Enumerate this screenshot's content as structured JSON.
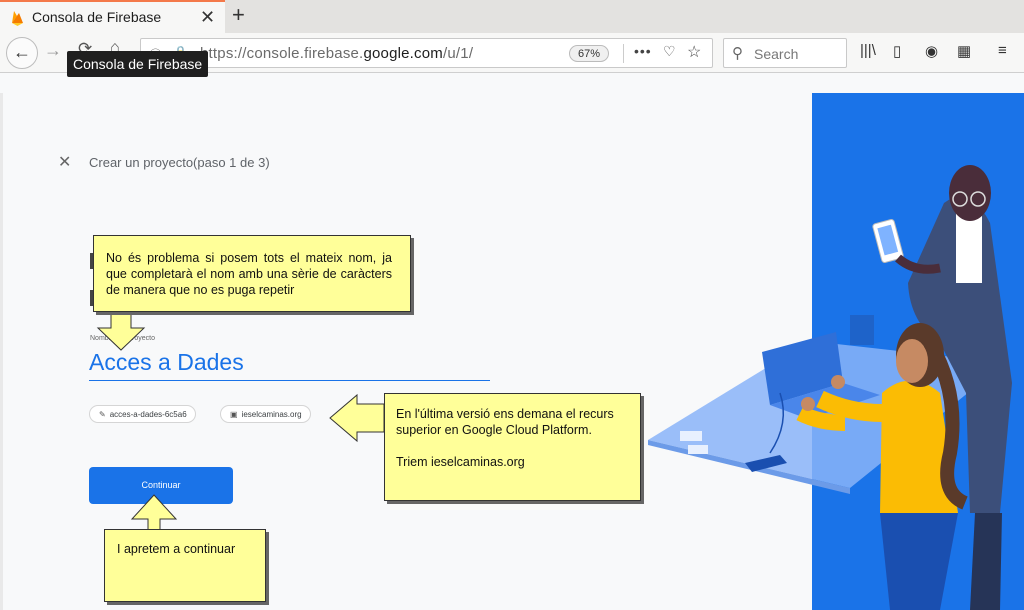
{
  "browser": {
    "tab_title": "Consola de Firebase",
    "url_prefix": "https://console.firebase.",
    "url_domain": "google.com",
    "url_path": "/u/1/",
    "zoom": "67%",
    "search_placeholder": "Search",
    "tooltip": "Consola de Firebase"
  },
  "page": {
    "step_title": "Crear un proyecto(paso 1 de 3)",
    "field_label": "Nombre del proyecto",
    "project_name": "Acces a Dades",
    "project_id_chip": "acces-a-dades-6c5a6",
    "parent_resource_chip": "ieselcaminas.org",
    "continue_label": "Continuar"
  },
  "annotations": {
    "note1": "No és problema si posem tots el mateix nom, ja que completarà el nom amb una sèrie de caràcters de manera que no es puga repetir",
    "note2_line1": "En l'última versió ens demana el recurs superior en Google Cloud Platform.",
    "note2_line2": "Triem ieselcaminas.org",
    "note3": "I apretem a continuar"
  },
  "colors": {
    "accent": "#1a73e8",
    "note_bg": "#ffff99",
    "illustration_blue": "#1a73e8"
  },
  "icons": [
    "firefox-tab-favicon-flame",
    "close-icon",
    "plus-icon",
    "back-arrow-icon",
    "forward-arrow-icon",
    "reload-icon",
    "home-icon",
    "info-icon",
    "lock-icon",
    "more-icon",
    "pocket-icon",
    "star-icon",
    "search-icon",
    "library-icon",
    "sidebar-icon",
    "account-icon",
    "grid-icon",
    "menu-icon",
    "pencil-icon",
    "org-icon"
  ]
}
